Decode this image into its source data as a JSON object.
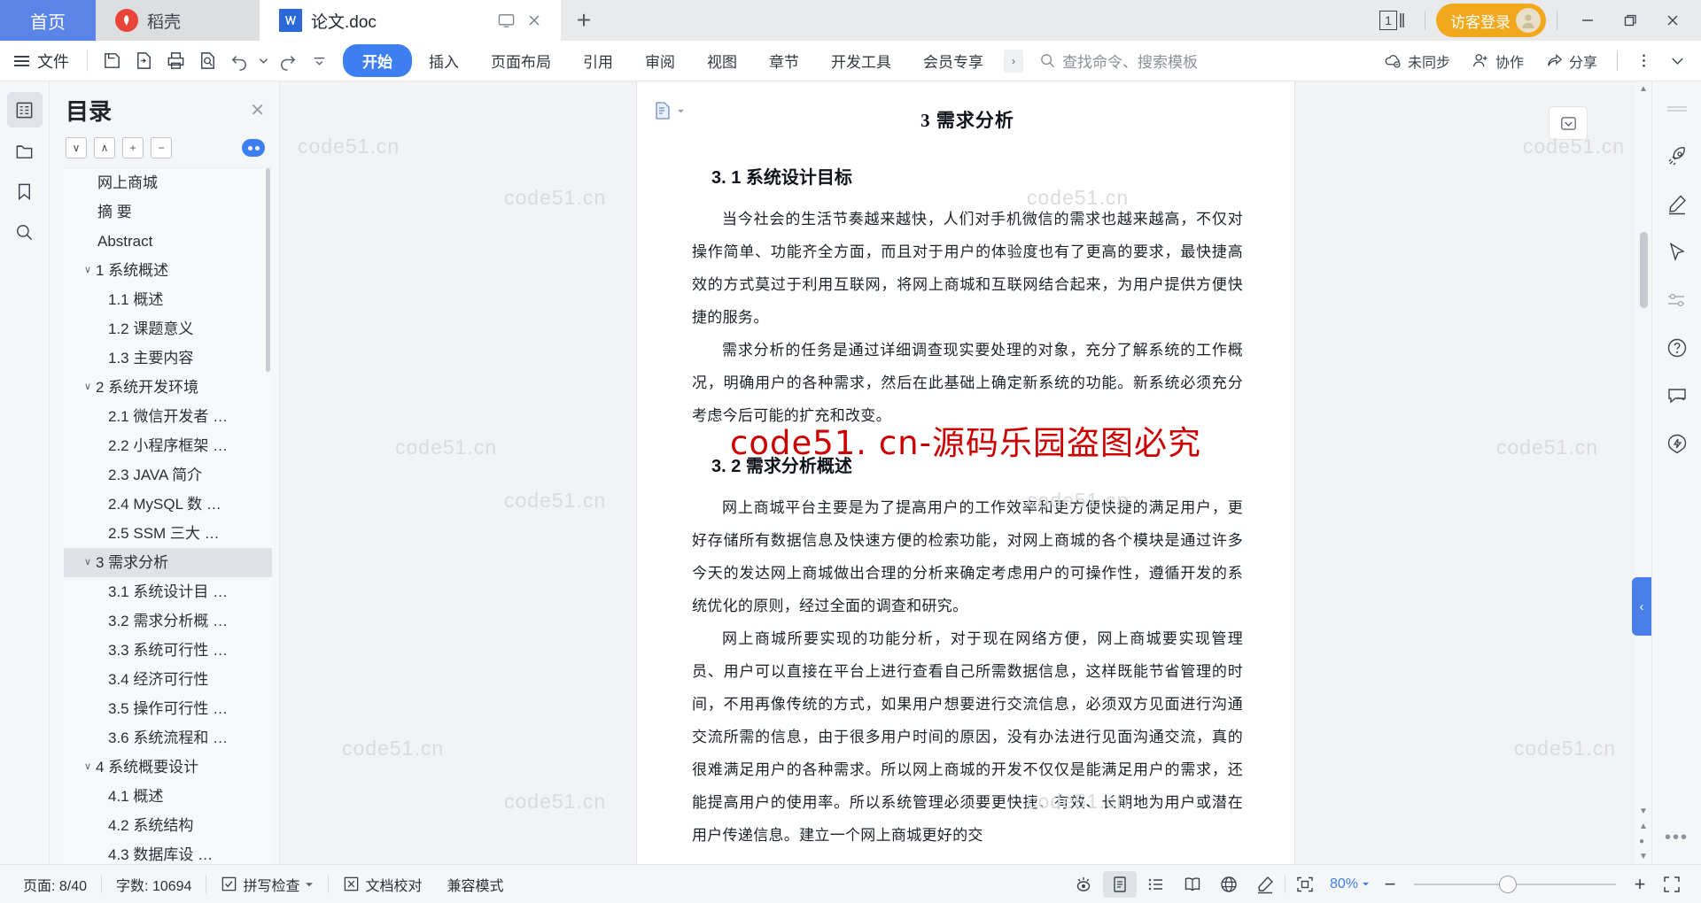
{
  "window": {
    "tabs": [
      {
        "label": "首页",
        "icon": "home-tab",
        "active": false
      },
      {
        "label": "稻壳",
        "icon": "daoke-icon",
        "active": false
      },
      {
        "label": "论文.doc",
        "icon": "wps-writer-icon",
        "active": true
      }
    ],
    "new_tab_label": "+",
    "page_count_badge": "1",
    "guest_login_label": "访客登录",
    "minimize_label": "—",
    "maximize_label": "❐",
    "close_label": "✕"
  },
  "ribbon": {
    "file_label": "文件",
    "quick_access": [
      "save-icon",
      "export-pdf-icon",
      "print-icon",
      "print-preview-icon",
      "undo-icon",
      "undo-dropdown-icon",
      "redo-icon",
      "customize-qat-icon"
    ],
    "tabs": [
      {
        "label": "开始",
        "active": true
      },
      {
        "label": "插入",
        "active": false
      },
      {
        "label": "页面布局",
        "active": false
      },
      {
        "label": "引用",
        "active": false
      },
      {
        "label": "审阅",
        "active": false
      },
      {
        "label": "视图",
        "active": false
      },
      {
        "label": "章节",
        "active": false
      },
      {
        "label": "开发工具",
        "active": false
      },
      {
        "label": "会员专享",
        "active": false
      }
    ],
    "more_tabs_label": "›",
    "search_placeholder": "查找命令、搜索模板",
    "sync_label": "未同步",
    "collab_label": "协作",
    "share_label": "分享",
    "overflow_label": "⋮",
    "collapse_label": "∨"
  },
  "left_rail": {
    "items": [
      {
        "name": "toc-panel",
        "active": true
      },
      {
        "name": "folder-panel",
        "active": false
      },
      {
        "name": "bookmark-panel",
        "active": false
      },
      {
        "name": "search-panel",
        "active": false
      }
    ]
  },
  "nav_pane": {
    "title": "目录",
    "close_label": "✕",
    "tools": [
      {
        "name": "collapse-down-button",
        "glyph": "∨"
      },
      {
        "name": "collapse-up-button",
        "glyph": "∧"
      },
      {
        "name": "expand-all-button",
        "glyph": "+"
      },
      {
        "name": "collapse-all-button",
        "glyph": "−"
      }
    ],
    "eye_toggle": "eye-toggle",
    "items": [
      {
        "text": "网上商城",
        "level": 0,
        "chevron": "",
        "selected": false
      },
      {
        "text": "摘  要",
        "level": 0,
        "chevron": "",
        "selected": false
      },
      {
        "text": "Abstract",
        "level": 0,
        "chevron": "",
        "selected": false
      },
      {
        "text": "1 系统概述",
        "level": 1,
        "chevron": "∨",
        "selected": false
      },
      {
        "text": "1.1  概述",
        "level": 2,
        "chevron": "",
        "selected": false
      },
      {
        "text": "1.2 课题意义",
        "level": 2,
        "chevron": "",
        "selected": false
      },
      {
        "text": "1.3  主要内容",
        "level": 2,
        "chevron": "",
        "selected": false
      },
      {
        "text": "2 系统开发环境",
        "level": 1,
        "chevron": "∨",
        "selected": false
      },
      {
        "text": "2.1 微信开发者 …",
        "level": 2,
        "chevron": "",
        "selected": false
      },
      {
        "text": "2.2 小程序框架 …",
        "level": 2,
        "chevron": "",
        "selected": false
      },
      {
        "text": "2.3 JAVA 简介",
        "level": 2,
        "chevron": "",
        "selected": false
      },
      {
        "text": "2.4 MySQL 数 …",
        "level": 2,
        "chevron": "",
        "selected": false
      },
      {
        "text": "2.5 SSM 三大 …",
        "level": 2,
        "chevron": "",
        "selected": false
      },
      {
        "text": "3 需求分析",
        "level": 1,
        "chevron": "∨",
        "selected": true
      },
      {
        "text": "3.1 系统设计目 …",
        "level": 2,
        "chevron": "",
        "selected": false
      },
      {
        "text": "3.2 需求分析概 …",
        "level": 2,
        "chevron": "",
        "selected": false
      },
      {
        "text": "3.3  系统可行性 …",
        "level": 2,
        "chevron": "",
        "selected": false
      },
      {
        "text": "3.4 经济可行性",
        "level": 2,
        "chevron": "",
        "selected": false
      },
      {
        "text": "3.5 操作可行性 …",
        "level": 2,
        "chevron": "",
        "selected": false
      },
      {
        "text": "3.6 系统流程和 …",
        "level": 2,
        "chevron": "",
        "selected": false
      },
      {
        "text": "4 系统概要设计",
        "level": 1,
        "chevron": "∨",
        "selected": false
      },
      {
        "text": "4.1  概述",
        "level": 2,
        "chevron": "",
        "selected": false
      },
      {
        "text": "4.2  系统结构",
        "level": 2,
        "chevron": "",
        "selected": false
      },
      {
        "text": "4.3  数据库设 …",
        "level": 2,
        "chevron": "",
        "selected": false
      }
    ]
  },
  "document": {
    "heading1": "3 需求分析",
    "heading_3_1": "3. 1  系统设计目标",
    "heading_3_2": "3. 2 需求分析概述",
    "paragraphs": [
      "当今社会的生活节奏越来越快，人们对手机微信的需求也越来越高，不仅对操作简单、功能齐全方面，而且对于用户的体验度也有了更高的要求，最快捷高效的方式莫过于利用互联网，将网上商城和互联网结合起来，为用户提供方便快捷的服务。",
      "需求分析的任务是通过详细调查现实要处理的对象，充分了解系统的工作概况，明确用户的各种需求，然后在此基础上确定新系统的功能。新系统必须充分考虑今后可能的扩充和改变。",
      "网上商城平台主要是为了提高用户的工作效率和更方便快捷的满足用户，更好存储所有数据信息及快速方便的检索功能，对网上商城的各个模块是通过许多今天的发达网上商城做出合理的分析来确定考虑用户的可操作性，遵循开发的系统优化的原则，经过全面的调查和研究。",
      "网上商城所要实现的功能分析，对于现在网络方便，网上商城要实现管理员、用户可以直接在平台上进行查看自己所需数据信息，这样既能节省管理的时间，不用再像传统的方式，如果用户想要进行交流信息，必须双方见面进行沟通交流所需的信息，由于很多用户时间的原因，没有办法进行见面沟通交流，真的很难满足用户的各种需求。所以网上商城的开发不仅仅是能满足用户的需求，还能提高用户的使用率。所以系统管理必须要更快捷、有效、长期地为用户或潜在用户传递信息。建立一个网上商城更好的交"
    ],
    "red_watermark": "code51. cn-源码乐园盗图必究",
    "gray_watermark": "code51.cn"
  },
  "right_pane": {
    "items": [
      {
        "name": "divider"
      },
      {
        "name": "rocket-icon"
      },
      {
        "name": "pen-icon"
      },
      {
        "name": "cursor-icon"
      },
      {
        "name": "sliders-icon"
      },
      {
        "name": "help-icon"
      },
      {
        "name": "feedback-icon"
      },
      {
        "name": "lightning-icon"
      }
    ],
    "more_label": "•••",
    "edge_tab_label": "‹"
  },
  "status_bar": {
    "page_label": "页面: 8/40",
    "word_count_label": "字数: 10694",
    "spellcheck_label": "拼写检查",
    "proofread_label": "文档校对",
    "compat_label": "兼容模式",
    "view_icons": [
      {
        "name": "focus-mode-icon",
        "active": false
      },
      {
        "name": "page-view-icon",
        "active": true
      },
      {
        "name": "outline-view-icon",
        "active": false
      },
      {
        "name": "reading-view-icon",
        "active": false
      },
      {
        "name": "web-view-icon",
        "active": false
      },
      {
        "name": "highlighter-icon",
        "active": false
      }
    ],
    "fit-icon": "fit-page-icon",
    "zoom_value": "80%",
    "zoom_out_label": "−",
    "zoom_in_label": "+",
    "fullscreen_label": "fullscreen-icon"
  },
  "colors": {
    "accent_blue": "#3d7ff0",
    "tab_home_blue": "#5b84e8",
    "guest_orange": "#f2a81c",
    "watermark_red": "#cc0000",
    "watermark_gray": "#d9dbdd",
    "selected_toc": "#dfe3e8"
  }
}
